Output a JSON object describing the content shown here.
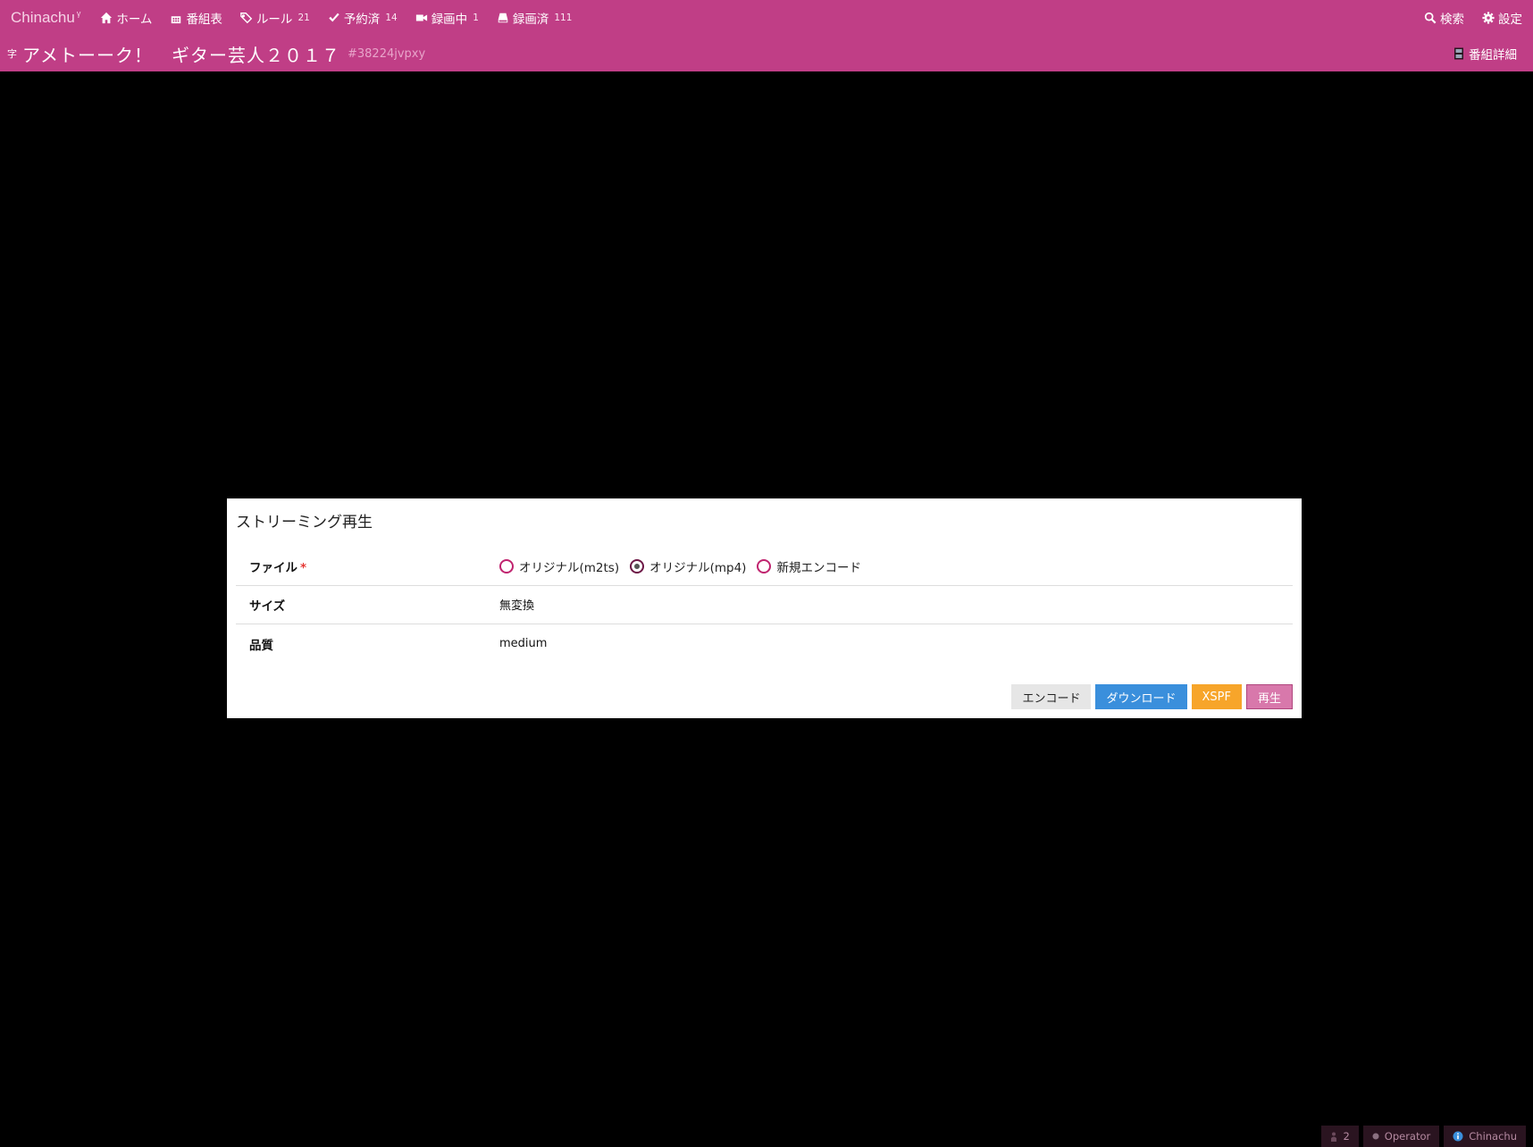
{
  "app": {
    "brand": "Chinachu",
    "brand_sup": "γ"
  },
  "nav": {
    "items": [
      {
        "icon": "home-icon",
        "label": "ホーム",
        "count": ""
      },
      {
        "icon": "calendar-icon",
        "label": "番組表",
        "count": ""
      },
      {
        "icon": "tags-icon",
        "label": "ルール",
        "count": "21"
      },
      {
        "icon": "check-icon",
        "label": "予約済",
        "count": "14"
      },
      {
        "icon": "video-camera-icon",
        "label": "録画中",
        "count": "1"
      },
      {
        "icon": "hdd-icon",
        "label": "録画済",
        "count": "111"
      }
    ],
    "right": [
      {
        "icon": "search-icon",
        "label": "検索"
      },
      {
        "icon": "gear-icon",
        "label": "設定"
      }
    ]
  },
  "program": {
    "subtitle_badge": "字",
    "title": "アメトーーク！　ギター芸人２０１７",
    "id": "#38224jvpxy",
    "detail_label": "番組詳細"
  },
  "dialog": {
    "title": "ストリーミング再生",
    "file_label": "ファイル",
    "required_mark": "*",
    "file_options": [
      {
        "label": "オリジナル(m2ts)",
        "selected": false
      },
      {
        "label": "オリジナル(mp4)",
        "selected": true
      },
      {
        "label": "新規エンコード",
        "selected": false
      }
    ],
    "size_label": "サイズ",
    "size_value": "無変換",
    "quality_label": "品質",
    "quality_value": "medium",
    "buttons": {
      "encode": "エンコード",
      "download": "ダウンロード",
      "xspf": "XSPF",
      "play": "再生"
    }
  },
  "status": {
    "count": "2",
    "operator": "Operator",
    "app": "Chinachu"
  },
  "colors": {
    "header": "#c03e86",
    "download": "#3a8fdc",
    "xspf": "#f7a52a",
    "play": "#d878ab"
  }
}
